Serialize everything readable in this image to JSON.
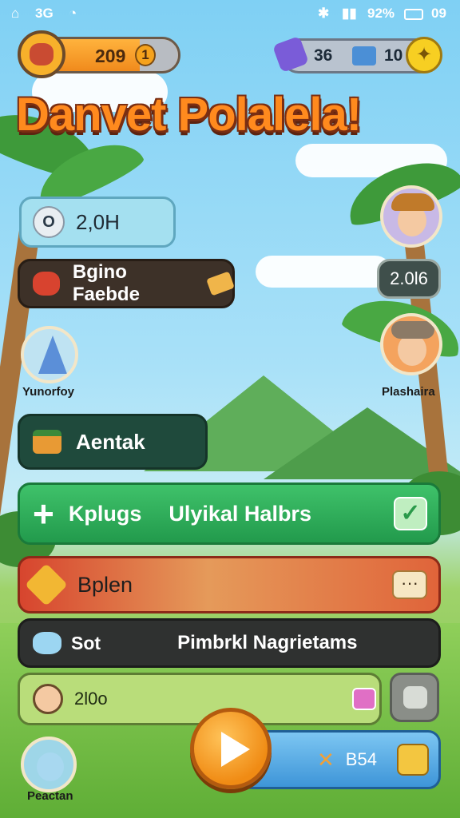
{
  "status_bar": {
    "left": "3G",
    "battery_text": "92%",
    "time": "09"
  },
  "hud": {
    "coins": "209",
    "coin_badge": "1",
    "gems": "36",
    "keys": "10"
  },
  "title": "Danvet Polalela!",
  "panels": {
    "score_chip": {
      "icon_text": "O",
      "value": "2,0H"
    },
    "bonus": {
      "label": "Bgino Faebde"
    },
    "right_value": "2.0l6",
    "aentak": {
      "label": "Aentak"
    },
    "kplugs": {
      "label_left": "Kplugs",
      "label_right": "Ulyikal Halbrs"
    },
    "bplen": {
      "label": "Bplen"
    },
    "sot": {
      "label_left": "Sot",
      "label_right": "Pimbrkl Nagrietams"
    },
    "bottom_value": "2l0o",
    "bottom_right_value": "B54"
  },
  "characters": {
    "left_top": "Yunorfoy",
    "right_bottom": "Plashaira",
    "left_bottom": "Peactan"
  }
}
